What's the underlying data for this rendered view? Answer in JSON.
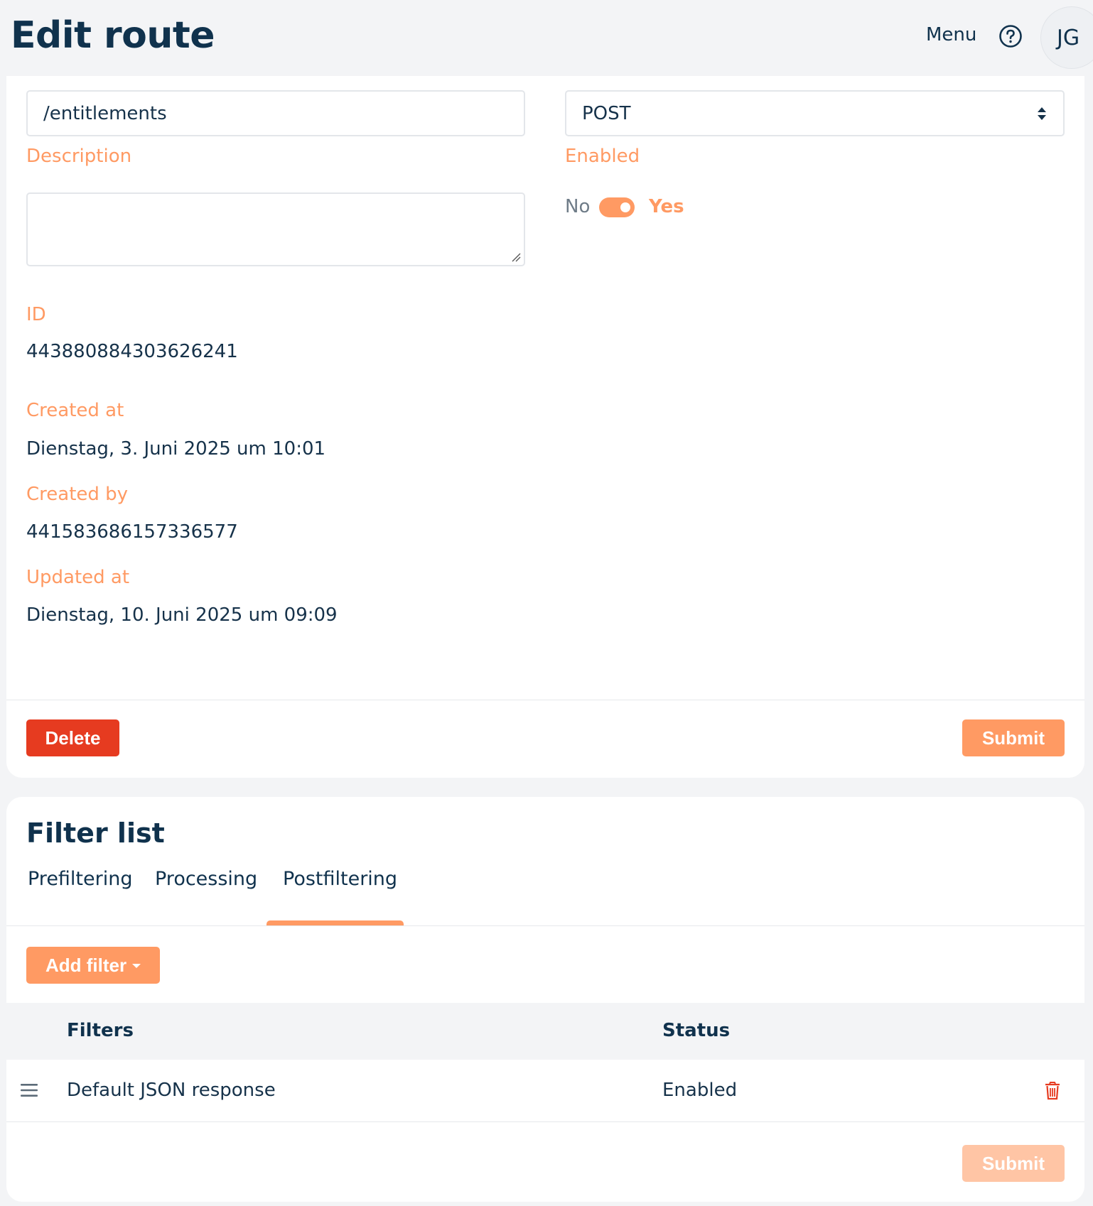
{
  "header": {
    "title": "Edit route",
    "menu_label": "Menu",
    "help_icon": "question-circle-icon",
    "avatar_initials": "JG"
  },
  "route_form": {
    "path_value": "/entitlements",
    "method_value": "POST",
    "description_label": "Description",
    "description_value": "",
    "enabled_label": "Enabled",
    "enabled_off_label": "No",
    "enabled_on_label": "Yes",
    "enabled": true,
    "id_label": "ID",
    "id_value": "443880884303626241",
    "created_at_label": "Created at",
    "created_at_value": "Dienstag, 3. Juni 2025 um 10:01",
    "created_by_label": "Created by",
    "created_by_value": "441583686157336577",
    "updated_at_label": "Updated at",
    "updated_at_value": "Dienstag, 10. Juni 2025 um 09:09",
    "delete_label": "Delete",
    "submit_label": "Submit"
  },
  "filter_list": {
    "title": "Filter list",
    "tabs": [
      {
        "label": "Prefiltering",
        "active": false
      },
      {
        "label": "Processing",
        "active": false
      },
      {
        "label": "Postfiltering",
        "active": true
      }
    ],
    "add_filter_label": "Add filter",
    "columns": [
      "Filters",
      "Status"
    ],
    "rows": [
      {
        "filter": "Default JSON response",
        "status": "Enabled"
      }
    ],
    "submit_label": "Submit"
  },
  "colors": {
    "accent": "#ff9a63",
    "danger": "#e63b20",
    "heading": "#10324d",
    "background": "#f3f4f6"
  }
}
